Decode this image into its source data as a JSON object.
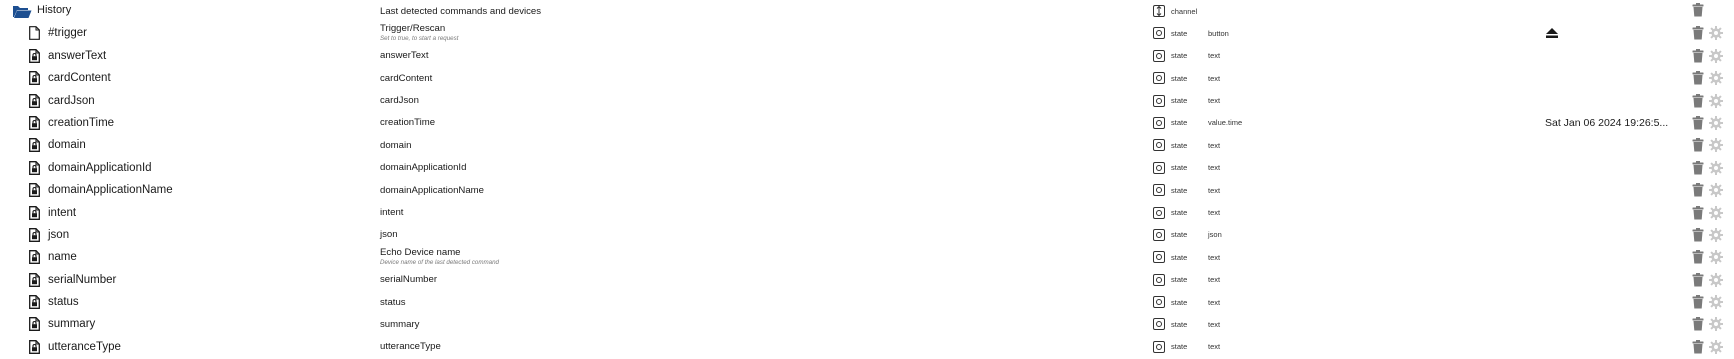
{
  "channel": {
    "id": "History",
    "name": "Last detected commands and devices",
    "type": "channel",
    "icon": "folder-open-icon"
  },
  "states": [
    {
      "id": "#trigger",
      "name": "Trigger/Rescan",
      "desc": "Set to true, to start a request",
      "type": "state",
      "role": "button",
      "value": "",
      "file_icon": "file-icon",
      "value_icon": "eject-icon"
    },
    {
      "id": "answerText",
      "name": "answerText",
      "desc": "",
      "type": "state",
      "role": "text",
      "value": "",
      "file_icon": "file-lock-icon"
    },
    {
      "id": "cardContent",
      "name": "cardContent",
      "desc": "",
      "type": "state",
      "role": "text",
      "value": "",
      "file_icon": "file-lock-icon"
    },
    {
      "id": "cardJson",
      "name": "cardJson",
      "desc": "",
      "type": "state",
      "role": "text",
      "value": "",
      "file_icon": "file-lock-icon"
    },
    {
      "id": "creationTime",
      "name": "creationTime",
      "desc": "",
      "type": "state",
      "role": "value.time",
      "value": "Sat Jan 06 2024 19:26:5...",
      "file_icon": "file-lock-icon"
    },
    {
      "id": "domain",
      "name": "domain",
      "desc": "",
      "type": "state",
      "role": "text",
      "value": "",
      "file_icon": "file-lock-icon"
    },
    {
      "id": "domainApplicationId",
      "name": "domainApplicationId",
      "desc": "",
      "type": "state",
      "role": "text",
      "value": "",
      "file_icon": "file-lock-icon"
    },
    {
      "id": "domainApplicationName",
      "name": "domainApplicationName",
      "desc": "",
      "type": "state",
      "role": "text",
      "value": "",
      "file_icon": "file-lock-icon"
    },
    {
      "id": "intent",
      "name": "intent",
      "desc": "",
      "type": "state",
      "role": "text",
      "value": "",
      "file_icon": "file-lock-icon"
    },
    {
      "id": "json",
      "name": "json",
      "desc": "",
      "type": "state",
      "role": "json",
      "value": "",
      "file_icon": "file-lock-icon"
    },
    {
      "id": "name",
      "name": "Echo Device name",
      "desc": "Device name of the last detected command",
      "type": "state",
      "role": "text",
      "value": "",
      "file_icon": "file-lock-icon"
    },
    {
      "id": "serialNumber",
      "name": "serialNumber",
      "desc": "",
      "type": "state",
      "role": "text",
      "value": "",
      "file_icon": "file-lock-icon"
    },
    {
      "id": "status",
      "name": "status",
      "desc": "",
      "type": "state",
      "role": "text",
      "value": "",
      "file_icon": "file-lock-icon"
    },
    {
      "id": "summary",
      "name": "summary",
      "desc": "",
      "type": "state",
      "role": "text",
      "value": "",
      "file_icon": "file-lock-icon"
    },
    {
      "id": "utteranceType",
      "name": "utteranceType",
      "desc": "",
      "type": "state",
      "role": "text",
      "value": "",
      "file_icon": "file-lock-icon"
    }
  ],
  "colors": {
    "folder": "#1d4f91",
    "icon": "#1a1a1a",
    "trash": "#7a7a7a",
    "gear": "#c8c8c8"
  }
}
